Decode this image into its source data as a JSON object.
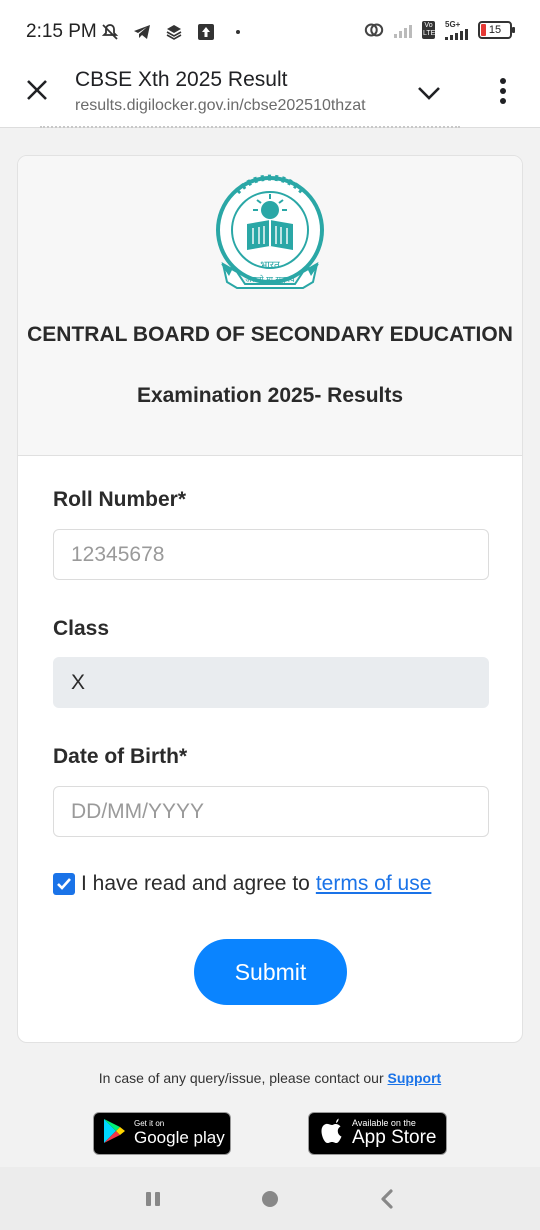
{
  "status_bar": {
    "time": "2:15 PM",
    "network_type": "5G+",
    "volte_label": "Vo LTE",
    "battery": "15",
    "icons": [
      "mute-icon",
      "telegram-icon",
      "layers-icon",
      "upload-icon",
      "hotspot-icon",
      "signal-icon",
      "battery-icon"
    ]
  },
  "browser": {
    "title": "CBSE Xth 2025 Result",
    "url": "results.digilocker.gov.in/cbse202510thzat"
  },
  "card": {
    "board_name": "CENTRAL BOARD OF SECONDARY EDUCATION",
    "exam_title": "Examination 2025- Results",
    "logo_top_text": "केन्द्रीय माध्यमिक शिक्षा बोर्ड",
    "logo_mid_text": "भारत",
    "logo_motto": "असतो मा सद्गमय"
  },
  "form": {
    "roll_label": "Roll Number*",
    "roll_placeholder": "12345678",
    "class_label": "Class",
    "class_value": "X",
    "dob_label": "Date of Birth*",
    "dob_placeholder": "DD/MM/YYYY",
    "agree_text": "I have read and agree to",
    "terms_link": "terms of use",
    "agree_checked": true,
    "submit_label": "Submit"
  },
  "footer": {
    "query_text": "In case of any query/issue, please contact our",
    "support_link": "Support",
    "google_play_small": "Get it on",
    "google_play_big": "Google play",
    "app_store_small": "Available on the",
    "app_store_big": "App Store"
  },
  "colors": {
    "accent": "#0a84ff",
    "link": "#1a73e8",
    "logo": "#2aa7a6"
  }
}
